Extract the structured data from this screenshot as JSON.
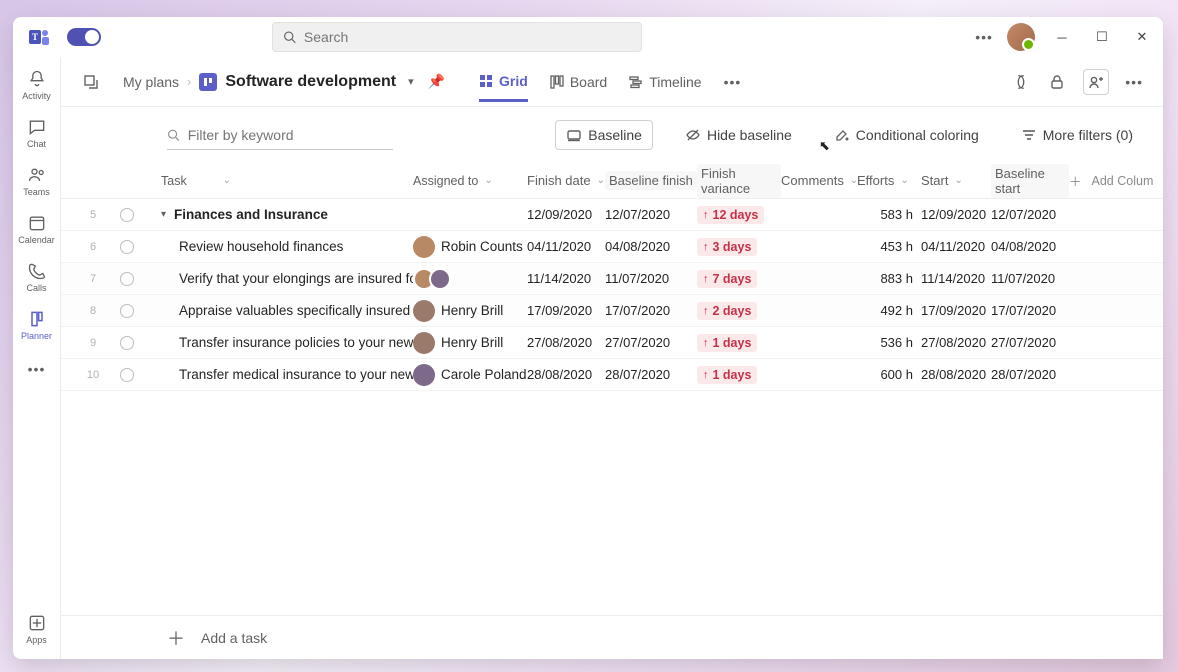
{
  "search": {
    "placeholder": "Search"
  },
  "rail": {
    "items": [
      {
        "id": "activity",
        "label": "Activity"
      },
      {
        "id": "chat",
        "label": "Chat"
      },
      {
        "id": "teams",
        "label": "Teams"
      },
      {
        "id": "calendar",
        "label": "Calendar"
      },
      {
        "id": "calls",
        "label": "Calls"
      },
      {
        "id": "planner",
        "label": "Planner"
      }
    ],
    "apps_label": "Apps"
  },
  "header": {
    "breadcrumb_root": "My plans",
    "plan_title": "Software development"
  },
  "views": {
    "grid": "Grid",
    "board": "Board",
    "timeline": "Timeline"
  },
  "toolbar": {
    "filter_placeholder": "Filter by keyword",
    "baseline": "Baseline",
    "hide_baseline": "Hide baseline",
    "conditional_coloring": "Conditional coloring",
    "more_filters": "More filters (0)"
  },
  "columns": {
    "task": "Task",
    "assigned_to": "Assigned to",
    "finish_date": "Finish date",
    "baseline_finish": "Baseline finish",
    "finish_variance": "Finish variance",
    "comments": "Comments",
    "efforts": "Efforts",
    "start": "Start",
    "baseline_start": "Baseline start",
    "add_column": "Add Colum"
  },
  "rows": [
    {
      "n": "5",
      "group": true,
      "task": "Finances and Insurance",
      "assigned": [],
      "names": "",
      "finish": "12/09/2020",
      "bfinish": "12/07/2020",
      "variance": "12 days",
      "efforts": "583 h",
      "start": "12/09/2020",
      "bstart": "12/07/2020"
    },
    {
      "n": "6",
      "task": "Review household finances",
      "assigned": [
        "a1"
      ],
      "names": "Robin Counts",
      "finish": "04/11/2020",
      "bfinish": "04/08/2020",
      "variance": "3 days",
      "efforts": "453 h",
      "start": "04/11/2020",
      "bstart": "04/08/2020"
    },
    {
      "n": "7",
      "task": "Verify that your elongings are insured for...",
      "assigned": [
        "a1",
        "a2"
      ],
      "names": "",
      "finish": "11/14/2020",
      "bfinish": "11/07/2020",
      "variance": "7 days",
      "efforts": "883 h",
      "start": "11/14/2020",
      "bstart": "11/07/2020"
    },
    {
      "n": "8",
      "task": "Appraise valuables specifically insured fo...",
      "assigned": [
        "a3"
      ],
      "names": "Henry Brill",
      "finish": "17/09/2020",
      "bfinish": "17/07/2020",
      "variance": "2 days",
      "efforts": "492 h",
      "start": "17/09/2020",
      "bstart": "17/07/2020"
    },
    {
      "n": "9",
      "task": "Transfer insurance policies to your new...",
      "assigned": [
        "a3"
      ],
      "names": "Henry Brill",
      "finish": "27/08/2020",
      "bfinish": "27/07/2020",
      "variance": "1 days",
      "efforts": "536 h",
      "start": "27/08/2020",
      "bstart": "27/07/2020"
    },
    {
      "n": "10",
      "task": "Transfer medical insurance to your new...",
      "assigned": [
        "a2"
      ],
      "names": "Carole Poland",
      "finish": "28/08/2020",
      "bfinish": "28/07/2020",
      "variance": "1 days",
      "efforts": "600 h",
      "start": "28/08/2020",
      "bstart": "28/07/2020"
    }
  ],
  "footer": {
    "add_task": "Add a task"
  }
}
